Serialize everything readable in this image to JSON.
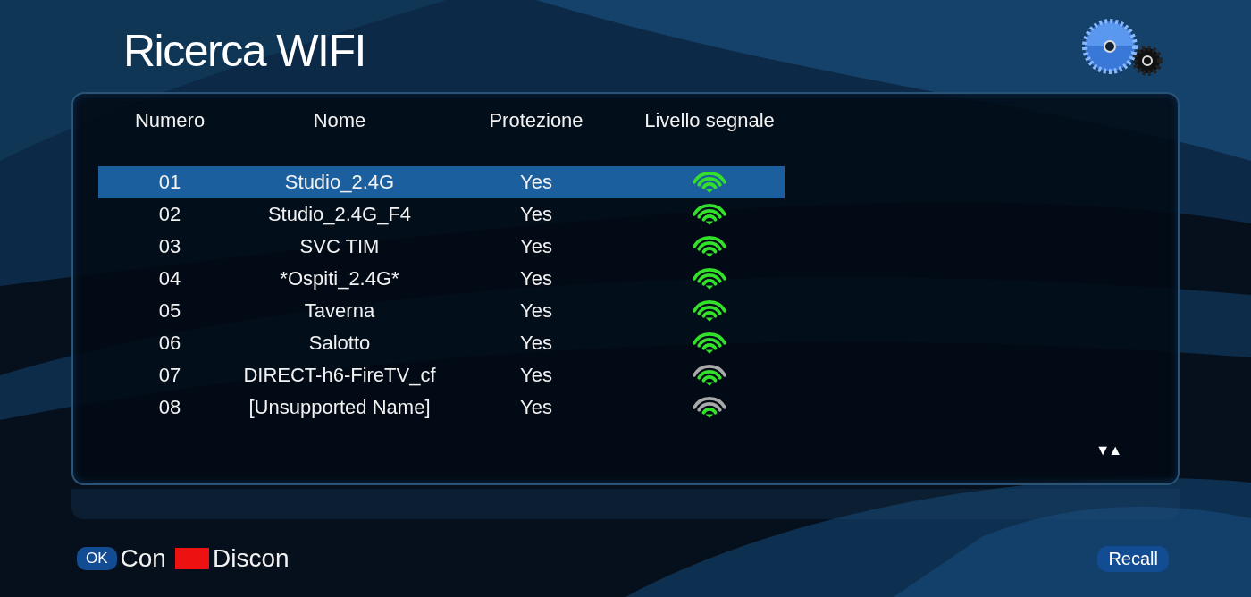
{
  "title": "Ricerca WIFI",
  "table": {
    "columns": [
      "Numero",
      "Nome",
      "Protezione",
      "Livello segnale"
    ],
    "rows": [
      {
        "kind": "strong",
        "number": "01",
        "name": "Studio_2.4G",
        "protection": "Yes",
        "selected": true
      },
      {
        "kind": "strong",
        "number": "02",
        "name": "Studio_2.4G_F4",
        "protection": "Yes",
        "selected": false
      },
      {
        "kind": "strong",
        "number": "03",
        "name": "SVC TIM",
        "protection": "Yes",
        "selected": false
      },
      {
        "kind": "strong",
        "number": "04",
        "name": "*Ospiti_2.4G*",
        "protection": "Yes",
        "selected": false
      },
      {
        "kind": "strong",
        "number": "05",
        "name": "Taverna",
        "protection": "Yes",
        "selected": false
      },
      {
        "kind": "strong",
        "number": "06",
        "name": "Salotto",
        "protection": "Yes",
        "selected": false
      },
      {
        "kind": "good",
        "number": "07",
        "name": "DIRECT-h6-FireTV_cf",
        "protection": "Yes",
        "selected": false
      },
      {
        "kind": "fair",
        "number": "08",
        "name": "[Unsupported Name]",
        "protection": "Yes",
        "selected": false
      }
    ]
  },
  "page_arrows": "▼▲",
  "footer": {
    "hints": [
      {
        "kind": "key",
        "key": "OK",
        "label": "Con"
      },
      {
        "kind": "color",
        "color": "#ee1111",
        "label": "Discon"
      }
    ],
    "recall": "Recall"
  }
}
